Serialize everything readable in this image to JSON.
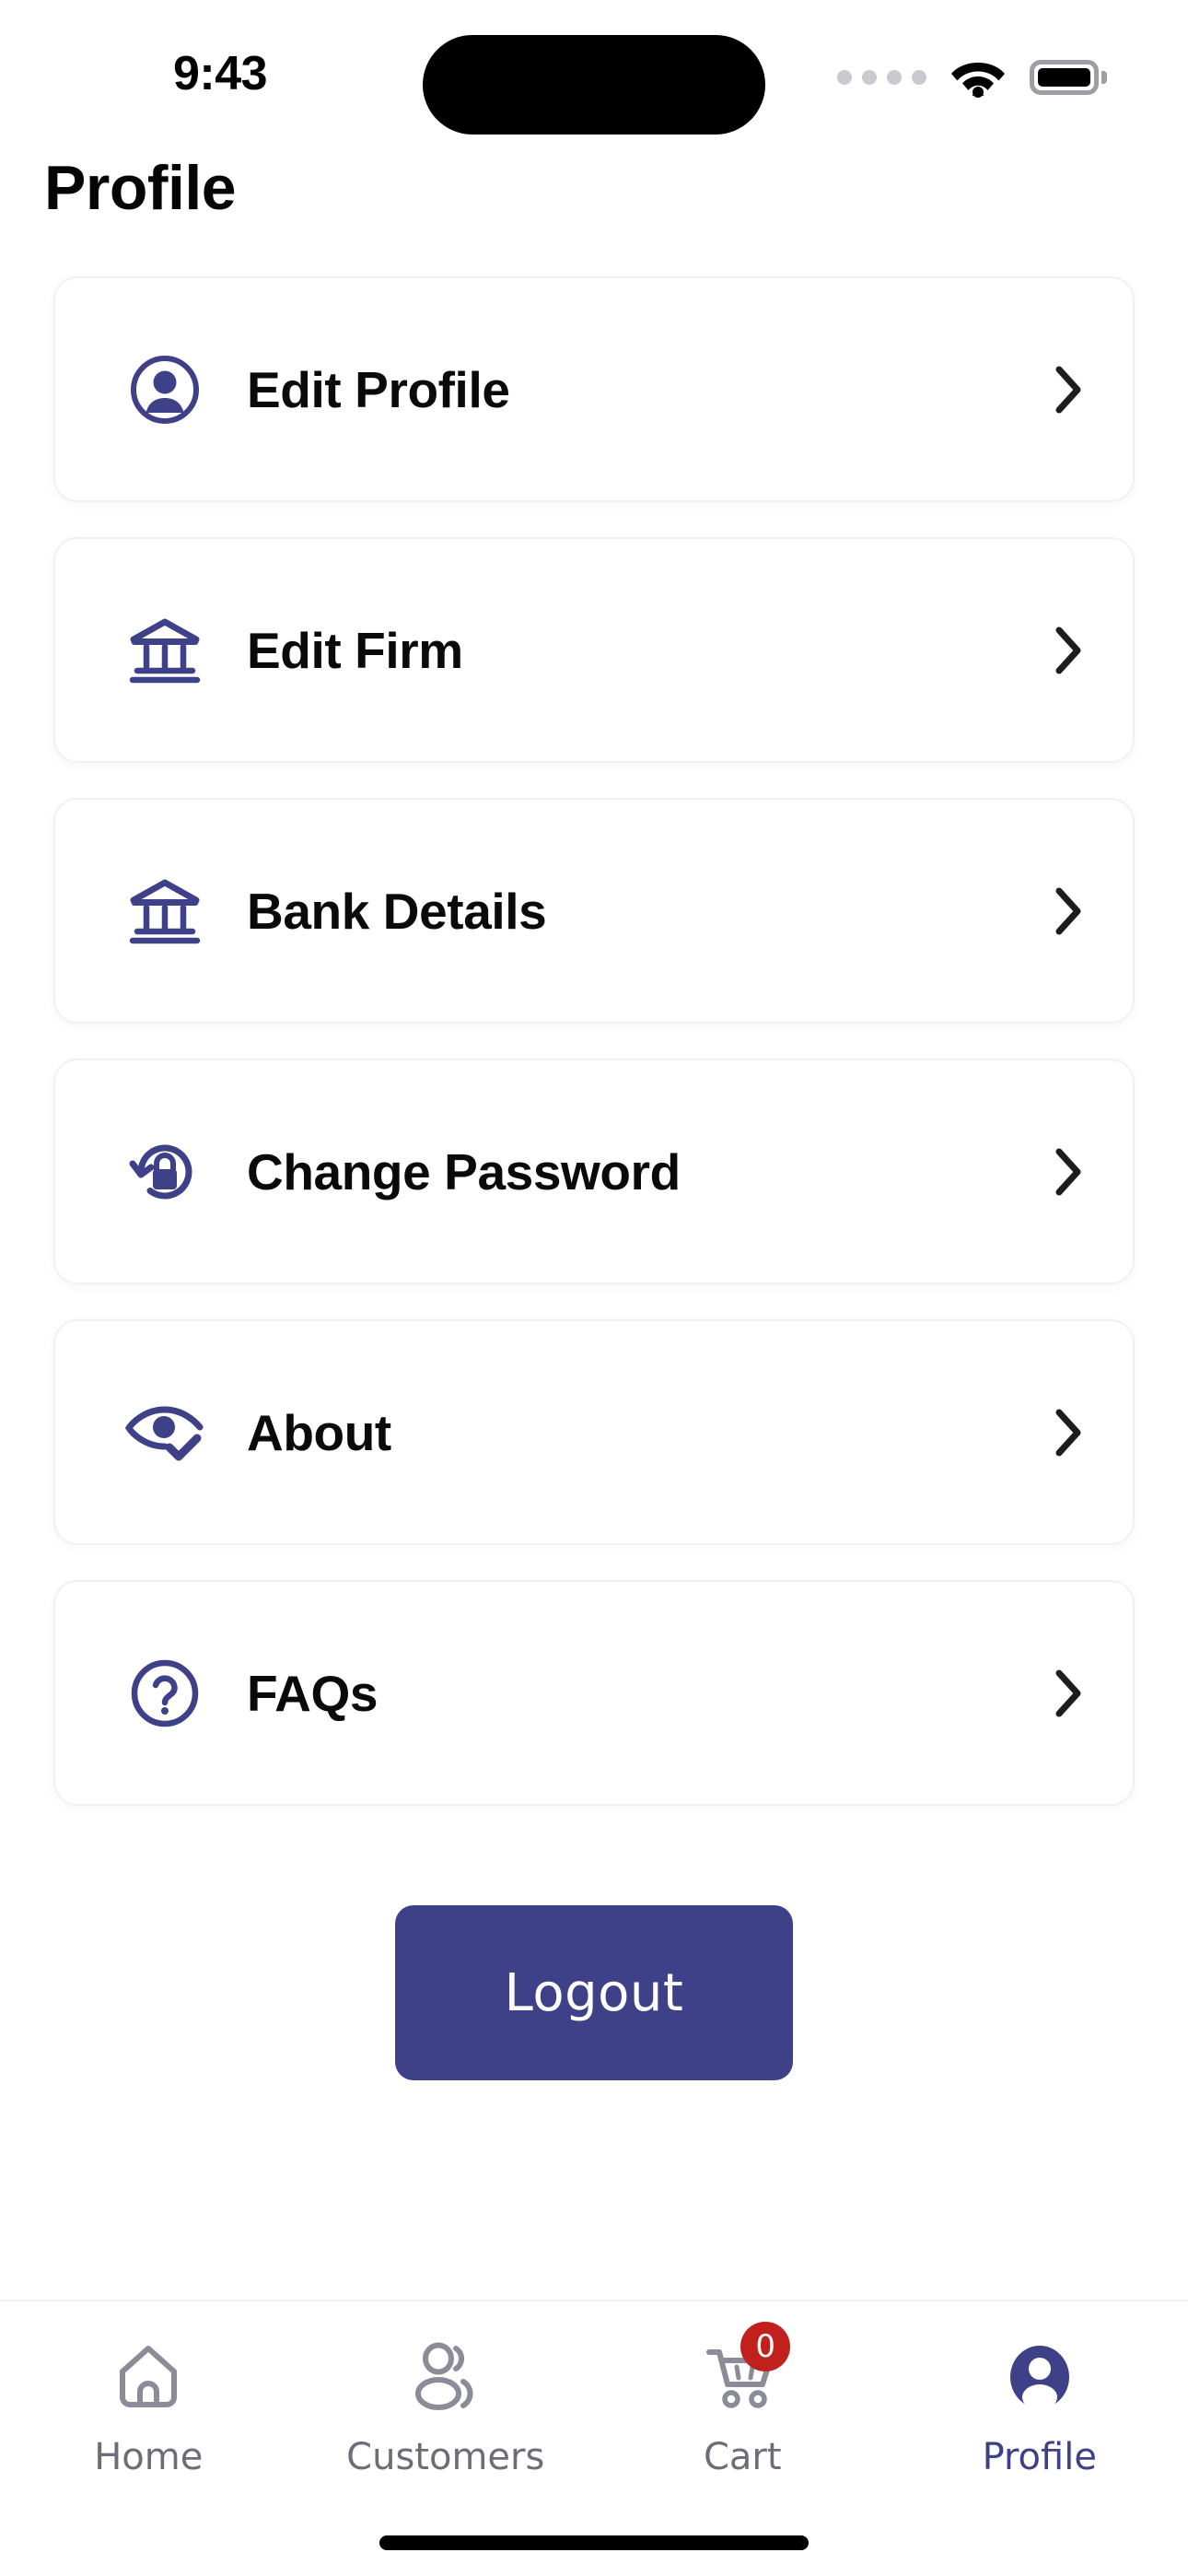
{
  "status_bar": {
    "time": "9:43",
    "signal_icon": "signal-dots-icon",
    "wifi_icon": "wifi-icon",
    "battery_icon": "battery-full-icon"
  },
  "header": {
    "title": "Profile"
  },
  "menu": {
    "items": [
      {
        "label": "Edit Profile",
        "icon": "user-circle-icon",
        "chevron": "chevron-right-icon"
      },
      {
        "label": "Edit Firm",
        "icon": "bank-icon",
        "chevron": "chevron-right-icon"
      },
      {
        "label": "Bank Details",
        "icon": "bank-icon",
        "chevron": "chevron-right-icon"
      },
      {
        "label": "Change Password",
        "icon": "reset-lock-icon",
        "chevron": "chevron-right-icon"
      },
      {
        "label": "About",
        "icon": "eye-check-icon",
        "chevron": "chevron-right-icon"
      },
      {
        "label": "FAQs",
        "icon": "question-circle-icon",
        "chevron": "chevron-right-icon"
      }
    ]
  },
  "actions": {
    "logout_label": "Logout"
  },
  "tabbar": {
    "tabs": [
      {
        "label": "Home",
        "icon": "home-icon",
        "active": false,
        "badge": null
      },
      {
        "label": "Customers",
        "icon": "users-icon",
        "active": false,
        "badge": null
      },
      {
        "label": "Cart",
        "icon": "cart-icon",
        "active": false,
        "badge": "0"
      },
      {
        "label": "Profile",
        "icon": "person-icon",
        "active": true,
        "badge": null
      }
    ]
  },
  "colors": {
    "accent": "#3e4188",
    "badge": "#c2201d",
    "inactive_tab": "#6d6d78",
    "card_border": "#f1f1f5",
    "text": "#0a0a0a"
  }
}
